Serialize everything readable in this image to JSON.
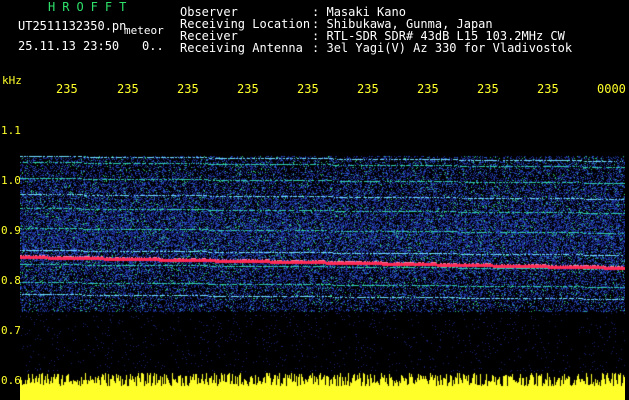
{
  "header": {
    "app_title": "HROFFT",
    "filename": "UT2511132350.pn",
    "filename_suffix": "meteor",
    "timestamp": "25.11.13 23:50",
    "timestamp_extra": "0..",
    "meta": [
      {
        "label": "Observer",
        "sep": ":",
        "value": "Masaki Kano"
      },
      {
        "label": "Receiving Location",
        "sep": ":",
        "value": "Shibukawa, Gunma, Japan"
      },
      {
        "label": "Receiver",
        "sep": ":",
        "value": "RTL-SDR SDR# 43dB L15 103.2MHz CW"
      },
      {
        "label": "Receiving Antenna",
        "sep": ":",
        "value": "3el Yagi(V) Az 330 for Vladivostok"
      }
    ]
  },
  "plot": {
    "y_unit": "kHz",
    "time_ticks": [
      "235",
      "235",
      "235",
      "235",
      "235",
      "235",
      "235",
      "235",
      "235",
      "0000"
    ],
    "freq_ticks": [
      "1.1",
      "1.0",
      "0.9",
      "0.8",
      "0.7",
      "0.6"
    ]
  },
  "colors": {
    "background": "#000000",
    "title_green": "#2ee06a",
    "axis_yellow": "#ffff2a",
    "spectrogram_blue": "#1c2a8c",
    "noise_green": "#2fd07a",
    "carrier_red": "#ff2a55"
  }
}
